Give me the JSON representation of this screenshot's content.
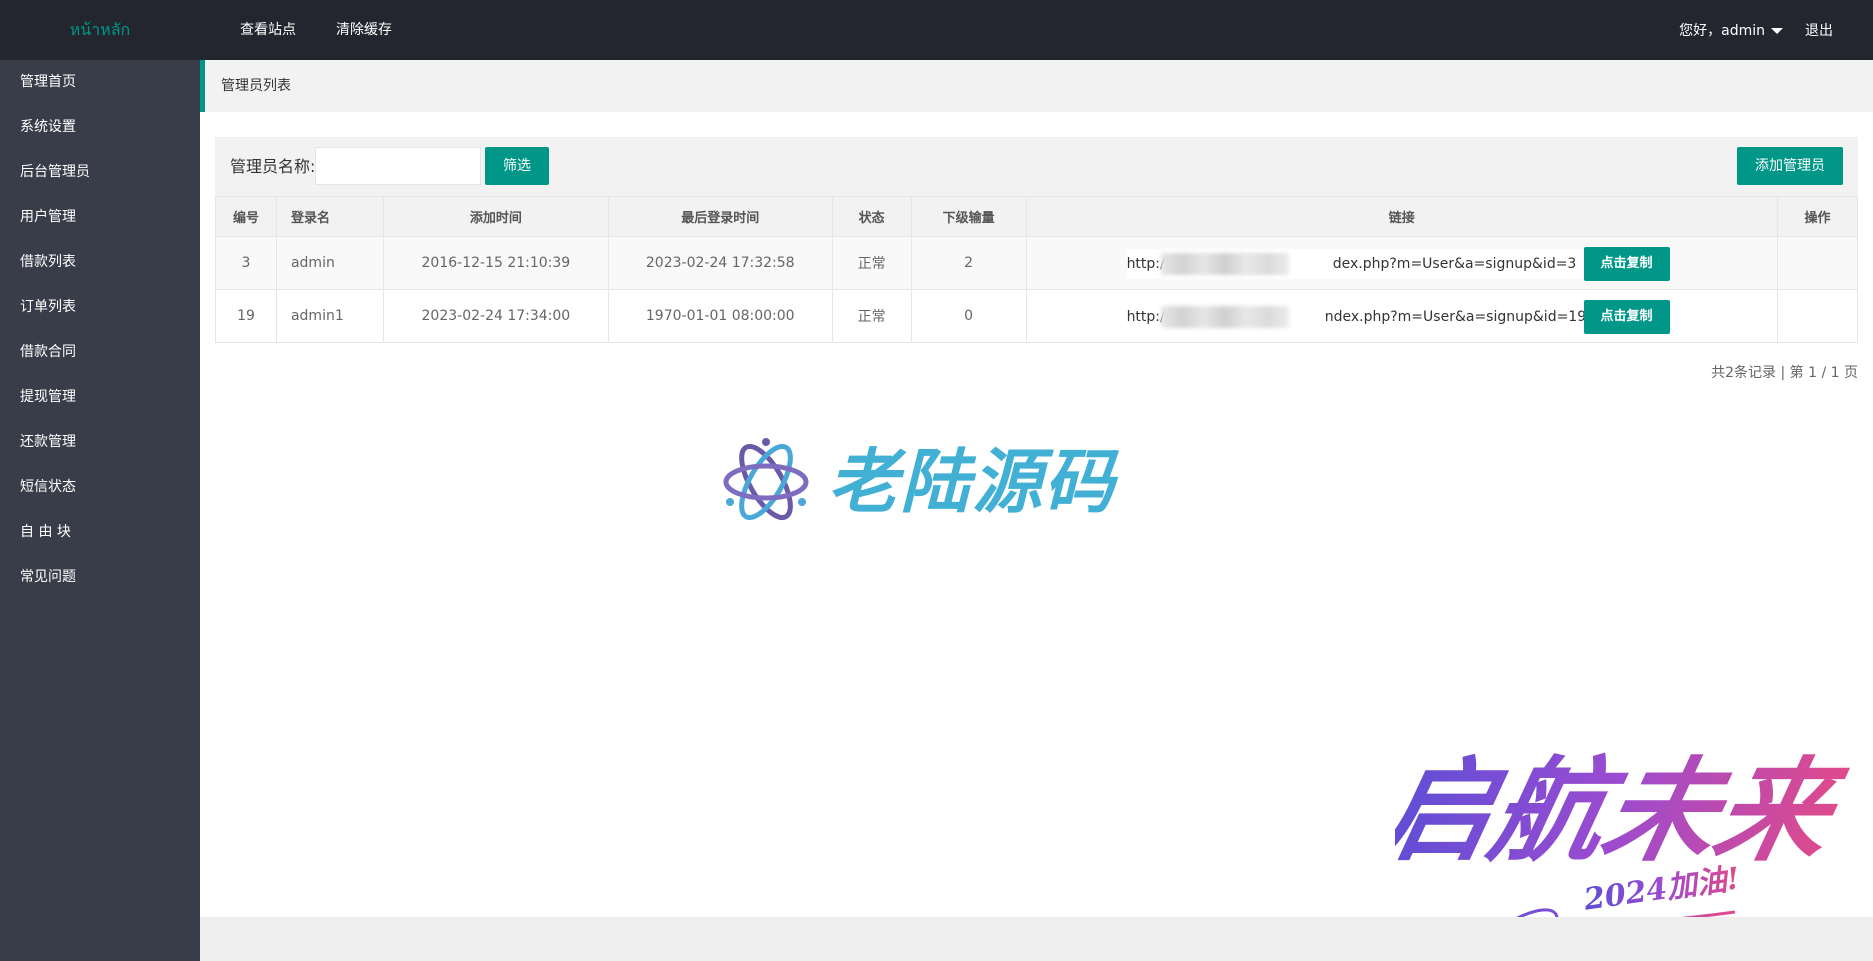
{
  "header": {
    "logo": "หน้าหลัก",
    "nav": [
      "查看站点",
      "清除缓存"
    ],
    "greeting": "您好，admin",
    "logout": "退出"
  },
  "sidebar": {
    "items": [
      {
        "label": "管理首页"
      },
      {
        "label": "系统设置"
      },
      {
        "label": "后台管理员"
      },
      {
        "label": "用户管理"
      },
      {
        "label": "借款列表"
      },
      {
        "label": "订单列表"
      },
      {
        "label": "借款合同"
      },
      {
        "label": "提现管理"
      },
      {
        "label": "还款管理"
      },
      {
        "label": "短信状态"
      },
      {
        "label": "自 由 块"
      },
      {
        "label": "常见问题"
      }
    ]
  },
  "breadcrumb": "管理员列表",
  "filter": {
    "label": "管理员名称:",
    "input_value": "",
    "input_placeholder": "",
    "filter_button": "筛选",
    "add_button": "添加管理员"
  },
  "table": {
    "columns": [
      "编号",
      "登录名",
      "添加时间",
      "最后登录时间",
      "状态",
      "下级输量",
      "链接",
      "操作"
    ],
    "rows": [
      {
        "id": "3",
        "login": "admin",
        "added": "2016-12-15 21:10:39",
        "last_login": "2023-02-24 17:32:58",
        "status": "正常",
        "subordinates": "2",
        "link_prefix": "http:/",
        "link_suffix": "dex.php?m=User&a=signup&id=3",
        "copy_button": "点击复制"
      },
      {
        "id": "19",
        "login": "admin1",
        "added": "2023-02-24 17:34:00",
        "last_login": "1970-01-01 08:00:00",
        "status": "正常",
        "subordinates": "0",
        "link_prefix": "http:/",
        "link_suffix": "ndex.php?m=User&a=signup&id=19",
        "copy_button": "点击复制"
      }
    ]
  },
  "pager": "共2条记录 | 第 1 / 1 页",
  "watermark": {
    "text": "老陆源码",
    "calligraphy": "启航未来",
    "calligraphy_sub": "2024加油!"
  },
  "colors": {
    "accent": "#009688",
    "topbar": "#23262e",
    "sidebar": "#393d49",
    "watermark": "#42b0d5"
  }
}
